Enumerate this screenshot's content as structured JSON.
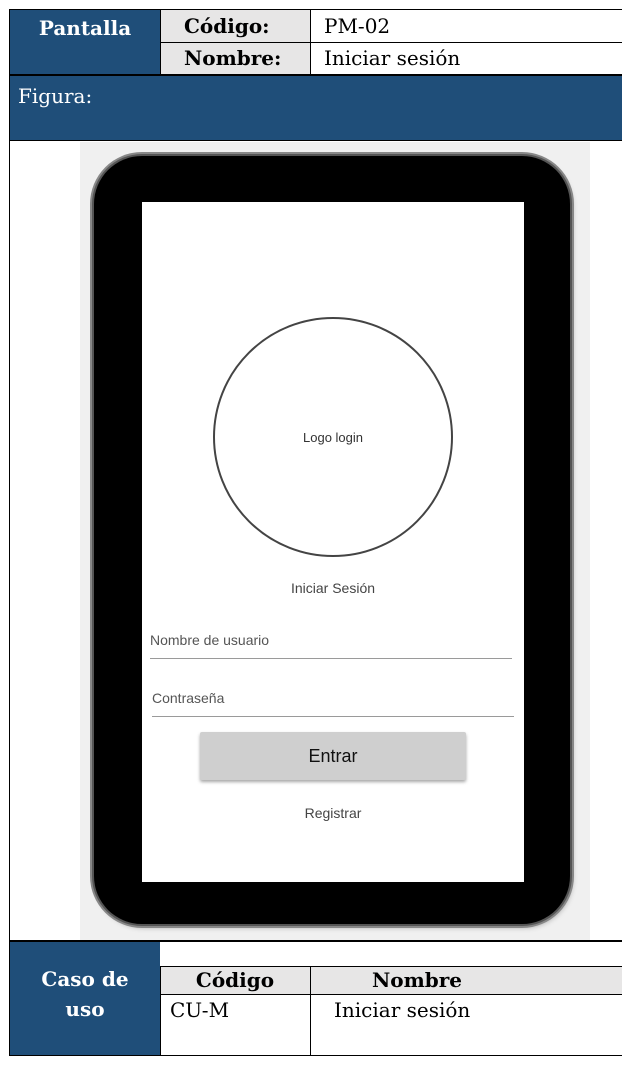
{
  "header": {
    "pantalla_label": "Pantalla",
    "codigo_label": "Código:",
    "codigo_value": "PM-02",
    "nombre_label": "Nombre:",
    "nombre_value": "Iniciar sesión",
    "figura_label": "Figura:"
  },
  "mockup": {
    "logo_text": "Logo login",
    "title": "Iniciar Sesión",
    "username_placeholder": "Nombre de usuario",
    "password_placeholder": "Contraseña",
    "enter_button": "Entrar",
    "register_link": "Registrar"
  },
  "footer": {
    "caso_label": "Caso de uso",
    "codigo_header": "Código",
    "nombre_header": "Nombre",
    "codigo_value": "CU-M",
    "nombre_value": "Iniciar sesión"
  },
  "colors": {
    "header_blue": "#1f4e79",
    "header_grey": "#e7e6e6"
  }
}
